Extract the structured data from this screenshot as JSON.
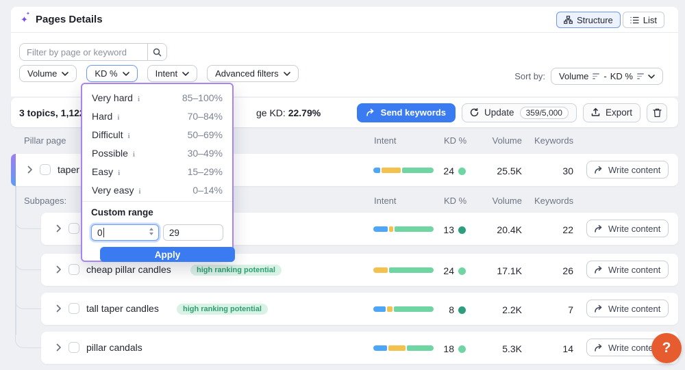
{
  "header": {
    "title": "Pages Details",
    "structure_label": "Structure",
    "list_label": "List"
  },
  "filters": {
    "search_placeholder": "Filter by page or keyword",
    "pills": {
      "volume": "Volume",
      "kd": "KD %",
      "intent": "Intent",
      "advanced": "Advanced filters"
    },
    "sort_label": "Sort by:",
    "sort_first": "Volume",
    "sort_sep": "-",
    "sort_second": "KD %"
  },
  "kd_dropdown": {
    "items": [
      {
        "label": "Very hard",
        "range": "85–100%"
      },
      {
        "label": "Hard",
        "range": "70–84%"
      },
      {
        "label": "Difficult",
        "range": "50–69%"
      },
      {
        "label": "Possible",
        "range": "30–49%"
      },
      {
        "label": "Easy",
        "range": "15–29%"
      },
      {
        "label": "Very easy",
        "range": "0–14%"
      }
    ],
    "info_icon": "i",
    "custom_range_label": "Custom range",
    "min_value": "0",
    "max_value": "29",
    "apply_label": "Apply"
  },
  "stats": {
    "summary": "3 topics, 1,122",
    "avg_prefix": "ge KD:",
    "avg_value": "22.79%",
    "send_keywords": "Send keywords",
    "update": "Update",
    "update_quota": "359/5,000",
    "export": "Export"
  },
  "table": {
    "pillar_header": "Pillar page",
    "subpages_label": "Subpages:",
    "columns": [
      "Intent",
      "KD %",
      "Volume",
      "Keywords"
    ],
    "write_content": "Write content",
    "pillar_row": {
      "name": "taper c",
      "intent": [
        12,
        33,
        55
      ],
      "kd": "24",
      "kd_level": "light",
      "volume": "25.5K",
      "keywords": "30"
    },
    "subpage_rows": [
      {
        "name": "",
        "badge": "",
        "intent": [
          25,
          7,
          68
        ],
        "kd": "13",
        "kd_level": "dark",
        "volume": "20.4K",
        "keywords": "22"
      },
      {
        "name": "cheap pillar candles",
        "badge": "high ranking potential",
        "intent": [
          0,
          24,
          76
        ],
        "kd": "24",
        "kd_level": "light",
        "volume": "17.1K",
        "keywords": "26"
      },
      {
        "name": "tall taper candles",
        "badge": "high ranking potential",
        "intent": [
          21,
          10,
          69
        ],
        "kd": "8",
        "kd_level": "dark",
        "volume": "2.2K",
        "keywords": "7"
      },
      {
        "name": "pillar candals",
        "badge": "",
        "intent": [
          24,
          30,
          46
        ],
        "kd": "18",
        "kd_level": "light",
        "volume": "5.3K",
        "keywords": "14"
      }
    ]
  },
  "help": {
    "label": "?"
  },
  "colors": {
    "primary_blue": "#3a7bf2",
    "panel_purple": "#a685f0",
    "intent_blue": "#4ea6f8",
    "intent_yellow": "#f2c14e",
    "intent_green": "#6fd5a3",
    "kd_light": "#6fd5a3",
    "kd_dark": "#2e9e7e",
    "badge_green": "#2f9e71",
    "help_orange": "#e65c2e"
  }
}
